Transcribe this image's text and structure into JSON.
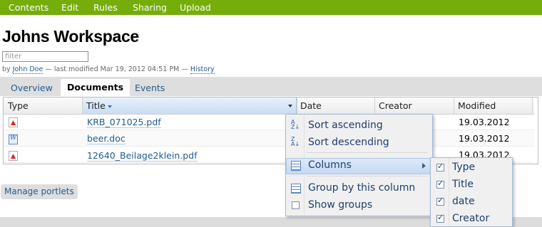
{
  "topbar": {
    "tabs": [
      "Contents",
      "Edit",
      "Rules",
      "Sharing",
      "Upload"
    ],
    "color": "#75ad0a"
  },
  "page": {
    "title": "Johns Workspace",
    "filter_placeholder": "filter",
    "byline": {
      "by": "by",
      "author": "John Doe",
      "modified": "— last modified Mar 19, 2012 04:51 PM —",
      "history": "History"
    }
  },
  "portal_tabs": [
    {
      "label": "Overview",
      "active": false
    },
    {
      "label": "Documents",
      "active": true
    },
    {
      "label": "Events",
      "active": false
    }
  ],
  "grid": {
    "columns": [
      "Type",
      "Title",
      "Date",
      "Creator",
      "Modified"
    ],
    "sorted_column": "Title",
    "rows": [
      {
        "type_icon": "pdf-file-icon",
        "title": "KRB_071025.pdf",
        "modified": "19.03.2012"
      },
      {
        "type_icon": "word-document-icon",
        "title": "beer.doc",
        "modified": "19.03.2012"
      },
      {
        "type_icon": "pdf-file-icon",
        "title": "12640_Beilage2klein.pdf",
        "modified": "19.03.2012"
      }
    ]
  },
  "column_menu": {
    "items": [
      "Sort ascending",
      "Sort descending",
      "Columns",
      "Group by this column",
      "Show groups"
    ],
    "highlighted": "Columns",
    "show_groups_checked": false
  },
  "columns_submenu": {
    "items": [
      {
        "label": "Type",
        "checked": true
      },
      {
        "label": "Title",
        "checked": true
      },
      {
        "label": "date",
        "checked": true
      },
      {
        "label": "Creator",
        "checked": true
      }
    ]
  },
  "manage_portlets": "Manage portlets",
  "accent": {
    "link": "#205c90",
    "menu_highlight": "#c6daf3"
  }
}
